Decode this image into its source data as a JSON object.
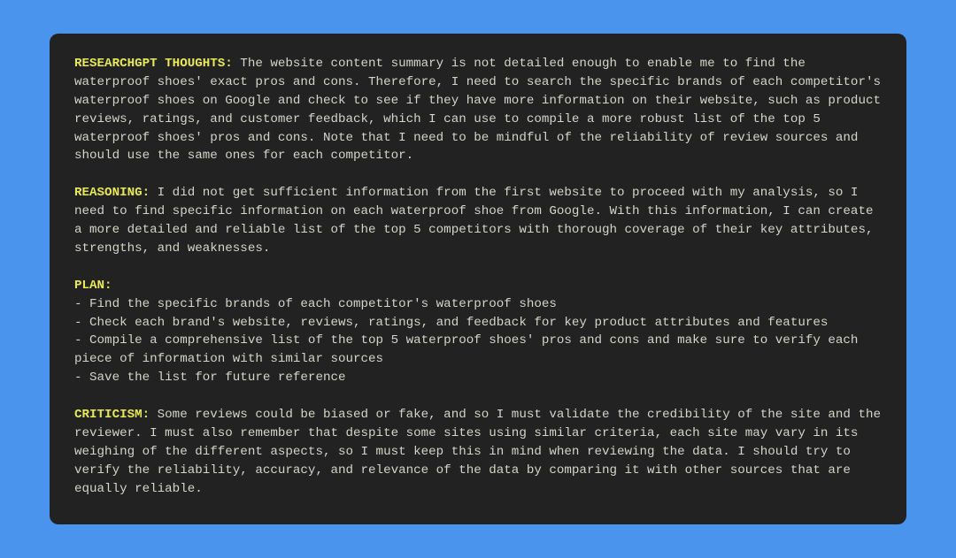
{
  "thoughts": {
    "label": "RESEARCHGPT THOUGHTS:",
    "text": " The website content summary is not detailed enough to enable me to find the waterproof shoes' exact pros and cons. Therefore, I need to search the specific brands of each competitor's waterproof shoes on Google and check to see if they have more information on their website, such as product reviews, ratings, and customer feedback, which I can use to compile a more robust list of the top 5 waterproof shoes' pros and cons. Note that I need to be mindful of the reliability of review sources and should use the same ones for each competitor."
  },
  "reasoning": {
    "label": "REASONING:",
    "text": " I did not get sufficient information from the first website to proceed with my analysis, so I need to find specific information on each waterproof shoe from Google. With this information, I can create a more detailed and reliable list of the top 5 competitors with thorough coverage of their key attributes, strengths, and weaknesses."
  },
  "plan": {
    "label": "PLAN:",
    "items": [
      "-  Find the specific brands of each competitor's waterproof shoes",
      "-  Check each brand's website, reviews, ratings, and feedback for key product attributes and features",
      "-  Compile a comprehensive list of the top 5 waterproof shoes' pros and cons and make sure to verify each piece of information with similar sources",
      "-  Save the list for future reference"
    ]
  },
  "criticism": {
    "label": "CRITICISM:",
    "text": " Some reviews could be biased or fake, and so I must validate the credibility of the site and the reviewer. I must also remember that despite some sites using similar criteria, each site may vary in its weighing of the different aspects, so I must keep this in mind when reviewing the data. I should try to verify the reliability, accuracy, and relevance of the data by comparing it with other sources that are equally reliable."
  }
}
